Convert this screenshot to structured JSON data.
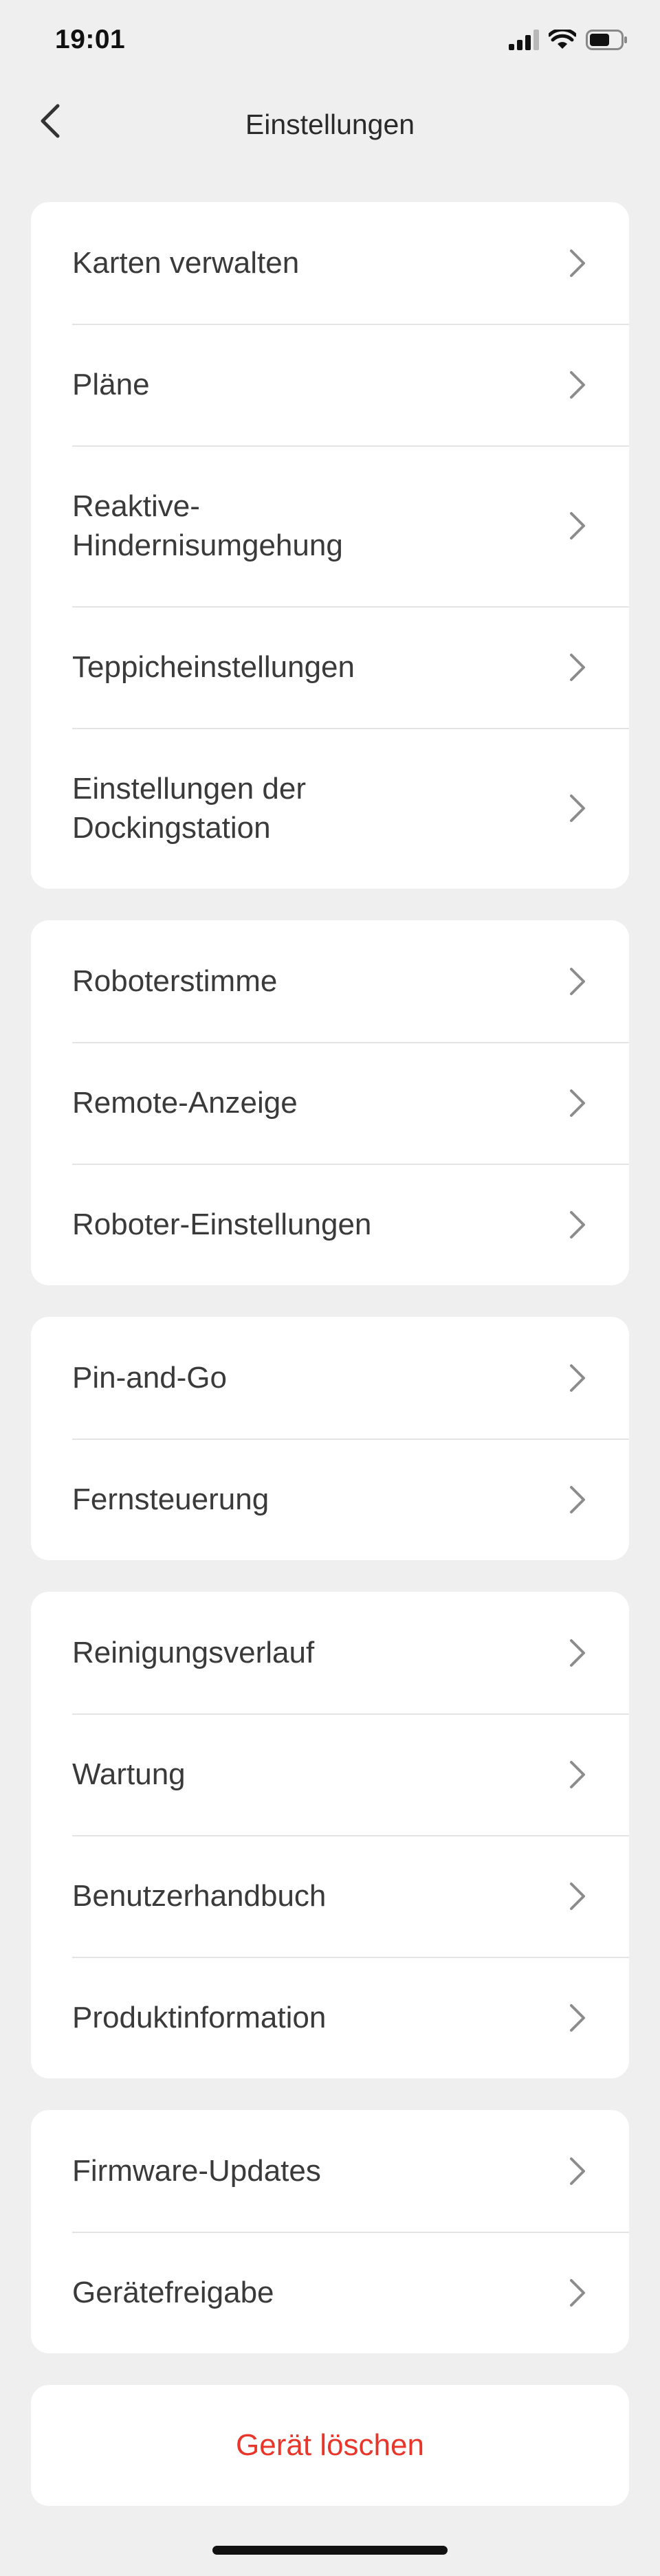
{
  "status_bar": {
    "time": "19:01"
  },
  "header": {
    "title": "Einstellungen"
  },
  "groups": [
    {
      "items": [
        {
          "label": "Karten verwalten"
        },
        {
          "label": "Pläne"
        },
        {
          "label": "Reaktive-\nHindernisumgehung"
        },
        {
          "label": "Teppicheinstellungen"
        },
        {
          "label": "Einstellungen der\nDockingstation"
        }
      ]
    },
    {
      "items": [
        {
          "label": "Roboterstimme"
        },
        {
          "label": "Remote-Anzeige"
        },
        {
          "label": "Roboter-Einstellungen"
        }
      ]
    },
    {
      "items": [
        {
          "label": "Pin-and-Go"
        },
        {
          "label": "Fernsteuerung"
        }
      ]
    },
    {
      "items": [
        {
          "label": "Reinigungsverlauf"
        },
        {
          "label": "Wartung"
        },
        {
          "label": "Benutzerhandbuch"
        },
        {
          "label": "Produktinformation"
        }
      ]
    },
    {
      "items": [
        {
          "label": "Firmware-Updates"
        },
        {
          "label": "Gerätefreigabe"
        }
      ]
    }
  ],
  "delete_button": {
    "label": "Gerät löschen",
    "color": "#e8362a"
  },
  "colors": {
    "background": "#efefef",
    "card": "#ffffff",
    "text": "#3a3a3a",
    "chevron": "#8c8c8c",
    "separator": "#e4e4e4"
  }
}
